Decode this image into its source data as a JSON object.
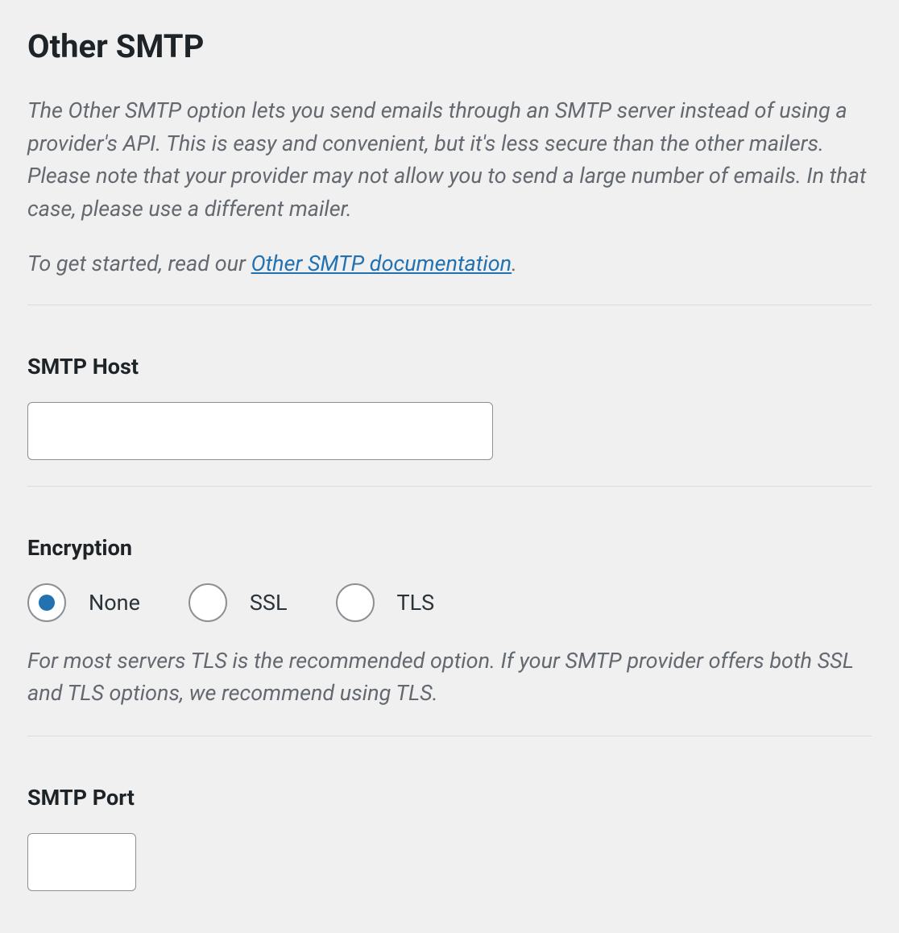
{
  "header": {
    "title": "Other SMTP",
    "description": "The Other SMTP option lets you send emails through an SMTP server instead of using a provider's API. This is easy and convenient, but it's less secure than the other mailers. Please note that your provider may not allow you to send a large number of emails. In that case, please use a different mailer.",
    "docs_lead": "To get started, read our ",
    "docs_link_text": "Other SMTP documentation",
    "docs_tail": "."
  },
  "smtp_host": {
    "label": "SMTP Host",
    "value": ""
  },
  "encryption": {
    "label": "Encryption",
    "options": [
      {
        "label": "None",
        "checked": true
      },
      {
        "label": "SSL",
        "checked": false
      },
      {
        "label": "TLS",
        "checked": false
      }
    ],
    "help": "For most servers TLS is the recommended option. If your SMTP provider offers both SSL and TLS options, we recommend using TLS."
  },
  "smtp_port": {
    "label": "SMTP Port",
    "value": ""
  }
}
